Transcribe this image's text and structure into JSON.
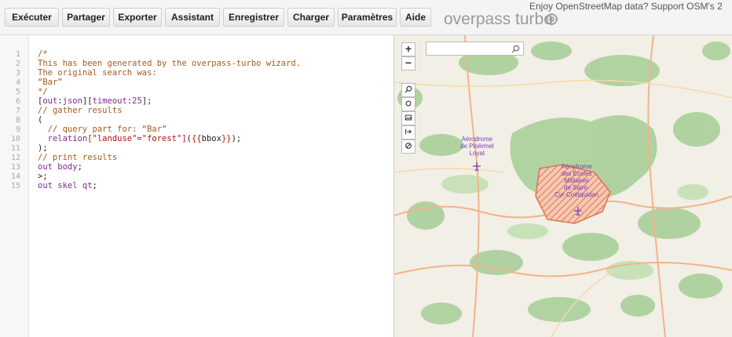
{
  "toolbar": {
    "buttons": [
      "Exécuter",
      "Partager",
      "Exporter",
      "Assistant",
      "Enregistrer",
      "Charger",
      "Paramètres",
      "Aide"
    ],
    "title": "overpass turbo",
    "osm_note": "Enjoy OpenStreetMap data? Support OSM's 2"
  },
  "editor": {
    "line_numbers": [
      "1",
      "2",
      "3",
      "4",
      "5",
      "6",
      "7",
      "8",
      "9",
      "10",
      "11",
      "12",
      "13",
      "14",
      "15"
    ],
    "lines": {
      "l1": "/*",
      "l2": "This has been generated by the overpass-turbo wizard.",
      "l3": "The original search was:",
      "l4": "“Bar”",
      "l5": "*/",
      "l6a": "[",
      "l6b": "out",
      "l6c": ":",
      "l6d": "json",
      "l6e": "][",
      "l6f": "timeout",
      "l6g": ":",
      "l6h": "25",
      "l6i": "];",
      "l7": "// gather results",
      "l8": "(",
      "l9": "  // query part for: “Bar”",
      "l10a": "  relation",
      "l10b": "[\"landuse\"=\"forest\"]",
      "l10c": "(",
      "l10d": "{{",
      "l10e": "bbox",
      "l10f": "}}",
      "l10g": ");",
      "l11": ");",
      "l12": "// print results",
      "l13a": "out",
      "l13b": " body",
      "l13c": ";",
      "l14": ">;",
      "l15a": "out",
      "l15b": " skel qt",
      "l15c": ";"
    }
  },
  "map": {
    "zoom_in": "+",
    "zoom_out": "−",
    "labels": {
      "aerodrome1": [
        "Aérodrome",
        "de Ploërmel",
        "Loyat"
      ],
      "aerodrome2": [
        "Aérodrome",
        "des Écoles",
        "Militaires",
        "de Saint-",
        "Cyr-Coëtquidan"
      ]
    },
    "colors": {
      "forest": "#add19e",
      "land": "#f1efe6",
      "highlight": "#e67e5a",
      "road": "#f2b38a",
      "label": "#7a3fb0"
    }
  }
}
